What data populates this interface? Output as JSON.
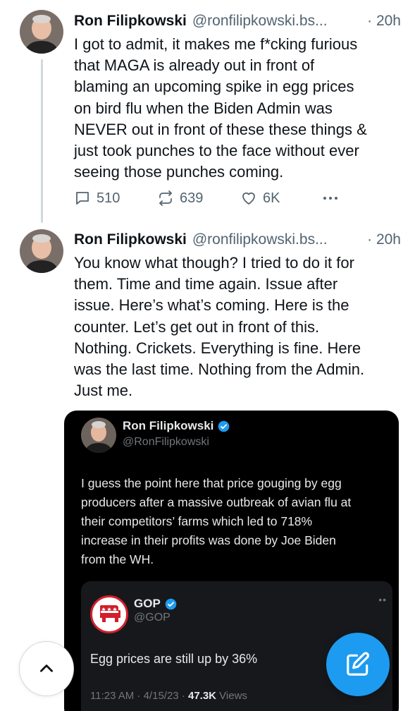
{
  "colors": {
    "accent": "#1d9bf0",
    "secondary_text": "#536471",
    "card_bg": "#000000",
    "gop_red": "#d21f2b"
  },
  "posts": [
    {
      "author_name": "Ron Filipkowski",
      "author_handle": "@ronfilipkowski.bs...",
      "time": "· 20h",
      "lines": [
        "I got to admit, it makes me f*cking furious",
        "that MAGA is already out in front of",
        "blaming an upcoming spike in egg prices",
        "on bird flu when the Biden Admin was",
        "NEVER out in front of these these things &",
        "just took punches to the face without ever",
        "seeing those punches coming."
      ],
      "replies": "510",
      "reposts": "639",
      "likes": "6K",
      "more_icon": "more-horizontal-icon"
    },
    {
      "author_name": "Ron Filipkowski",
      "author_handle": "@ronfilipkowski.bs...",
      "time": "· 20h",
      "lines": [
        "You know what though? I tried to do it for",
        "them. Time and time again. Issue after",
        "issue. Here’s what’s coming. Here is the",
        "counter. Let’s get out in front of this.",
        "Nothing. Crickets. Everything is fine. Here",
        "was the last time. Nothing from the Admin.",
        "Just me."
      ]
    }
  ],
  "quote": {
    "author_name": "Ron Filipkowski",
    "author_handle": "@RonFilipkowski",
    "lines": [
      "I guess the point here that price gouging by egg",
      "producers after a massive outbreak of avian flu at",
      "their competitors’ farms which led to 718%",
      "increase in their profits was done by Joe Biden",
      "from the WH."
    ],
    "nested": {
      "author_name": "GOP",
      "author_handle": "@GOP",
      "text": "Egg prices are still up by 36%",
      "timestamp": "11:23 AM · 4/15/23 · ",
      "views_count": "47.3K",
      "views_label": " Views"
    }
  },
  "fab": {
    "scroll_up_icon": "chevron-up-icon",
    "compose_icon": "compose-icon"
  }
}
